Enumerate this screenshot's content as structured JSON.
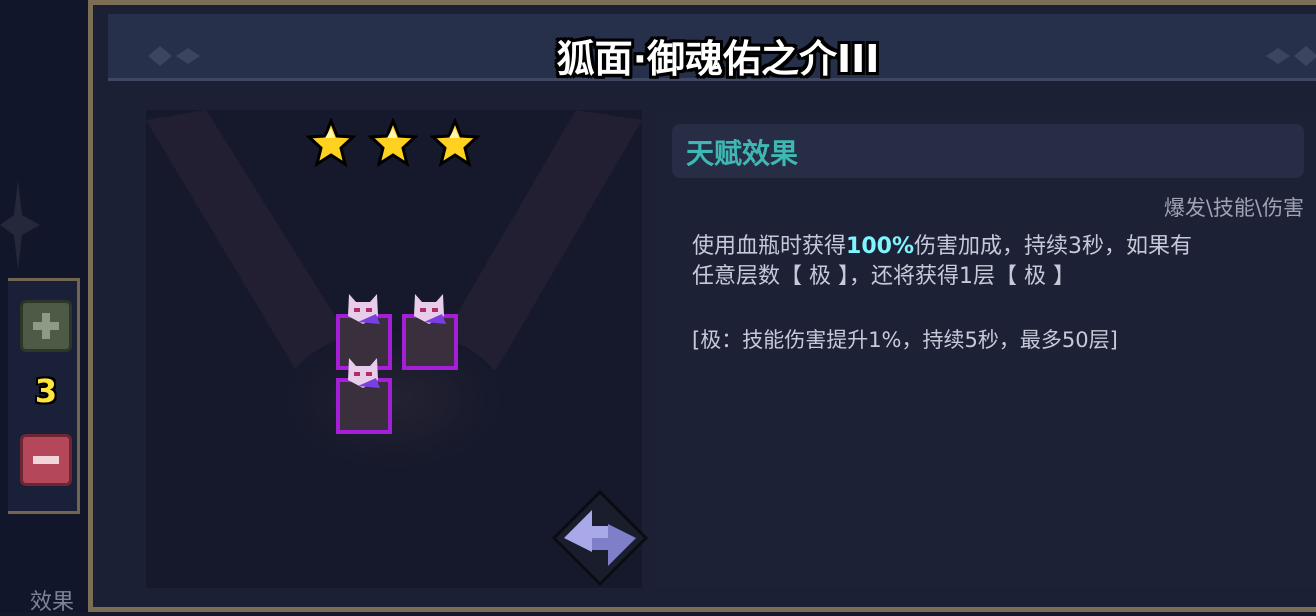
{
  "title": "狐面·御魂佑之介III",
  "stars": 3,
  "counter": {
    "value": "3",
    "plus_icon": "plus-icon",
    "minus_icon": "minus-icon"
  },
  "bottom_tab": "效果",
  "info": {
    "header": "天赋效果",
    "tags": "爆发\\技能\\伤害",
    "description": {
      "prefix": "使用血瓶时获得",
      "highlight": "100%",
      "suffix_line1": "伤害加成，持续3秒，如果有",
      "line2": "任意层数【 极 】，还将获得1层【 极 】"
    },
    "note": "[极：技能伤害提升1%，持续5秒，最多50层]"
  },
  "units": [
    "fox-mask-unit",
    "fox-mask-unit",
    "fox-mask-unit"
  ],
  "colors": {
    "accent": "#3fb8b3",
    "highlight": "#7ff6ff",
    "unit_border": "#a51fd8",
    "counter": "#ffe43a"
  }
}
